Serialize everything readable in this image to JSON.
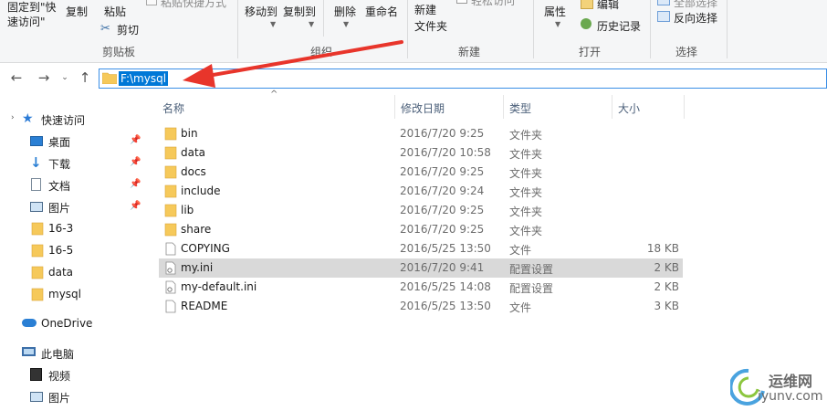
{
  "ribbon": {
    "clipboard": {
      "pin_label": "固定到\"快\n速访问\"",
      "copy": "复制",
      "paste": "粘贴",
      "paste_shortcut": "粘贴快捷方式",
      "cut": "剪切",
      "group_label": "剪贴板"
    },
    "organize": {
      "move_to": "移动到",
      "copy_to": "复制到",
      "delete": "删除",
      "rename": "重命名",
      "group_label": "组织"
    },
    "new": {
      "new_folder": "新建\n文件夹",
      "easy_access": "轻松访问",
      "group_label": "新建"
    },
    "open": {
      "properties": "属性",
      "edit": "编辑",
      "history": "历史记录",
      "group_label": "打开"
    },
    "select": {
      "select_all": "全部选择",
      "invert": "反向选择",
      "group_label": "选择"
    }
  },
  "address": {
    "path": "F:\\mysql"
  },
  "sidebar": {
    "items": [
      {
        "label": "快速访问",
        "icon": "star-icon"
      },
      {
        "label": "桌面",
        "icon": "desktop-icon",
        "pinned": true
      },
      {
        "label": "下载",
        "icon": "download-icon",
        "pinned": true
      },
      {
        "label": "文档",
        "icon": "document-icon",
        "pinned": true
      },
      {
        "label": "图片",
        "icon": "pictures-icon",
        "pinned": true
      },
      {
        "label": "16-3",
        "icon": "folder-icon"
      },
      {
        "label": "16-5",
        "icon": "folder-icon"
      },
      {
        "label": "data",
        "icon": "folder-icon"
      },
      {
        "label": "mysql",
        "icon": "folder-icon"
      },
      {
        "label": "OneDrive",
        "icon": "cloud-icon"
      },
      {
        "label": "此电脑",
        "icon": "computer-icon"
      },
      {
        "label": "视频",
        "icon": "video-icon"
      },
      {
        "label": "图片",
        "icon": "pictures-icon"
      }
    ]
  },
  "columns": {
    "name": "名称",
    "date": "修改日期",
    "type": "类型",
    "size": "大小"
  },
  "files": [
    {
      "name": "bin",
      "date": "2016/7/20 9:25",
      "type": "文件夹",
      "size": "",
      "icon": "folder-icon"
    },
    {
      "name": "data",
      "date": "2016/7/20 10:58",
      "type": "文件夹",
      "size": "",
      "icon": "folder-icon"
    },
    {
      "name": "docs",
      "date": "2016/7/20 9:25",
      "type": "文件夹",
      "size": "",
      "icon": "folder-icon"
    },
    {
      "name": "include",
      "date": "2016/7/20 9:24",
      "type": "文件夹",
      "size": "",
      "icon": "folder-icon"
    },
    {
      "name": "lib",
      "date": "2016/7/20 9:25",
      "type": "文件夹",
      "size": "",
      "icon": "folder-icon"
    },
    {
      "name": "share",
      "date": "2016/7/20 9:25",
      "type": "文件夹",
      "size": "",
      "icon": "folder-icon"
    },
    {
      "name": "COPYING",
      "date": "2016/5/25 13:50",
      "type": "文件",
      "size": "18 KB",
      "icon": "file-icon"
    },
    {
      "name": "my.ini",
      "date": "2016/7/20 9:41",
      "type": "配置设置",
      "size": "2 KB",
      "icon": "config-file-icon",
      "selected": true
    },
    {
      "name": "my-default.ini",
      "date": "2016/5/25 14:08",
      "type": "配置设置",
      "size": "2 KB",
      "icon": "config-file-icon"
    },
    {
      "name": "README",
      "date": "2016/5/25 13:50",
      "type": "文件",
      "size": "3 KB",
      "icon": "file-icon"
    }
  ],
  "watermark": {
    "line1": "运维网",
    "line2": "iyunv.com"
  },
  "colors": {
    "accent": "#0078d7",
    "folder": "#f6c95a",
    "annotation_arrow": "#e8352b",
    "selected_row": "#d9d9d9"
  }
}
